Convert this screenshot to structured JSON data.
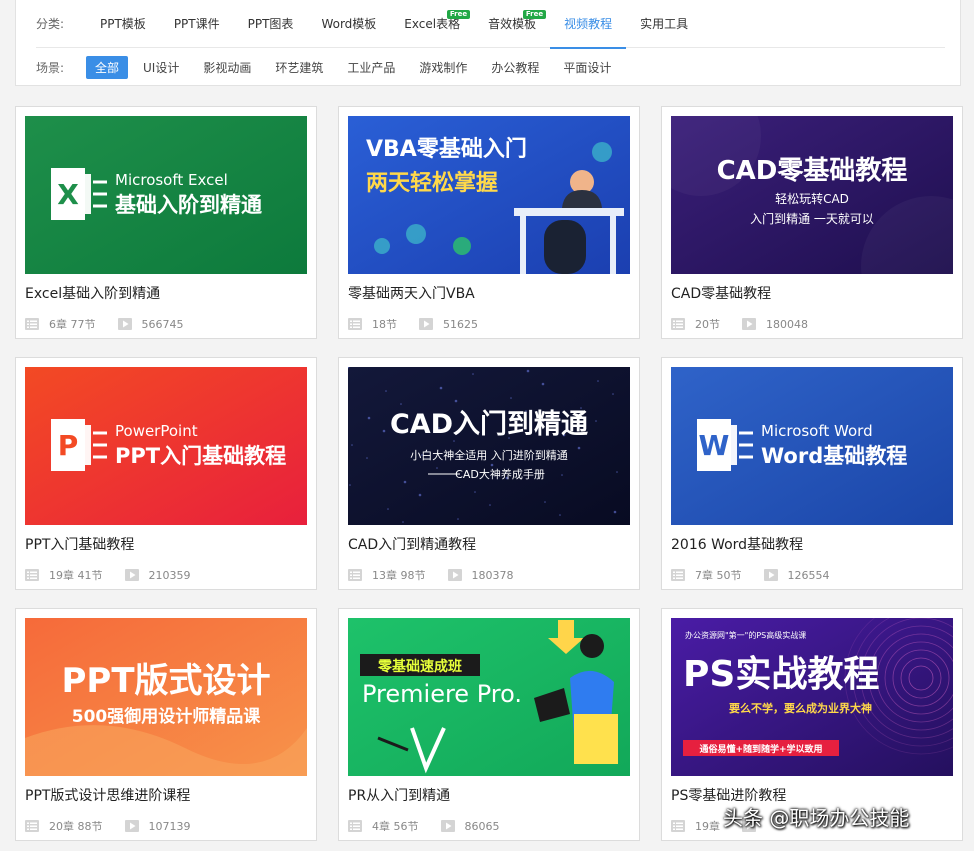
{
  "filters": {
    "category_label": "分类:",
    "categories": [
      {
        "label": "PPT模板",
        "free": false,
        "active": false
      },
      {
        "label": "PPT课件",
        "free": false,
        "active": false
      },
      {
        "label": "PPT图表",
        "free": false,
        "active": false
      },
      {
        "label": "Word模板",
        "free": false,
        "active": false
      },
      {
        "label": "Excel表格",
        "free": true,
        "active": false
      },
      {
        "label": "音效模板",
        "free": true,
        "active": false
      },
      {
        "label": "视频教程",
        "free": false,
        "active": true
      },
      {
        "label": "实用工具",
        "free": false,
        "active": false
      }
    ],
    "free_badge": "Free",
    "scene_label": "场景:",
    "scenes": [
      {
        "label": "全部",
        "active": true
      },
      {
        "label": "UI设计",
        "active": false
      },
      {
        "label": "影视动画",
        "active": false
      },
      {
        "label": "环艺建筑",
        "active": false
      },
      {
        "label": "工业产品",
        "active": false
      },
      {
        "label": "游戏制作",
        "active": false
      },
      {
        "label": "办公教程",
        "active": false
      },
      {
        "label": "平面设计",
        "active": false
      }
    ]
  },
  "courses": [
    {
      "title": "Excel基础入阶到精通",
      "sections": "6章 77节",
      "views": "566745",
      "thumb": {
        "style": "office",
        "bg1": "#1e8f4a",
        "bg2": "#0d7a3c",
        "app": "X",
        "app_name": "Microsoft Excel",
        "subtitle": "基础入阶到精通"
      }
    },
    {
      "title": "零基础两天入门VBA",
      "sections": "18节",
      "views": "51625",
      "thumb": {
        "style": "vba",
        "bg1": "#2a5fd6",
        "bg2": "#1b3fb0",
        "line1": "VBA零基础入门",
        "line2": "两天轻松掌握"
      }
    },
    {
      "title": "CAD零基础教程",
      "sections": "20节",
      "views": "180048",
      "thumb": {
        "style": "cad1",
        "bg1": "#3b1f7a",
        "bg2": "#1e0f4e",
        "line1": "CAD零基础教程",
        "line2": "轻松玩转CAD",
        "line3": "入门到精通 一天就可以"
      }
    },
    {
      "title": "PPT入门基础教程",
      "sections": "19章 41节",
      "views": "210359",
      "thumb": {
        "style": "office",
        "bg1": "#f34a24",
        "bg2": "#e8203c",
        "app": "P",
        "app_name": "PowerPoint",
        "subtitle": "PPT入门基础教程"
      }
    },
    {
      "title": "CAD入门到精通教程",
      "sections": "13章 98节",
      "views": "180378",
      "thumb": {
        "style": "cad2",
        "bg1": "#13183a",
        "bg2": "#080b22",
        "line1": "CAD入门到精通",
        "line2": "小白大神全适用 入门进阶到精通",
        "line3": "CAD大神养成手册"
      }
    },
    {
      "title": "2016 Word基础教程",
      "sections": "7章 50节",
      "views": "126554",
      "thumb": {
        "style": "office",
        "bg1": "#2f63c9",
        "bg2": "#1b46a8",
        "app": "W",
        "app_name": "Microsoft Word",
        "subtitle": "Word基础教程"
      }
    },
    {
      "title": "PPT版式设计思维进阶课程",
      "sections": "20章 88节",
      "views": "107139",
      "thumb": {
        "style": "pptdesign",
        "bg1": "#f66a3a",
        "bg2": "#f7934a",
        "line1": "PPT版式设计",
        "line2": "500强御用设计师精品课"
      }
    },
    {
      "title": "PR从入门到精通",
      "sections": "4章 56节",
      "views": "86065",
      "thumb": {
        "style": "pr",
        "bg1": "#1ec26a",
        "bg2": "#12a859",
        "line1": "零基础速成班",
        "line2": "Premiere Pro."
      }
    },
    {
      "title": "PS零基础进阶教程",
      "sections": "19章",
      "views": "",
      "thumb": {
        "style": "ps",
        "bg1": "#4a1ca6",
        "bg2": "#24105e",
        "line0": "办公资源网\"第一\"的PS高级实战课",
        "line1": "PS实战教程",
        "line2": "要么不学，要么成为业界大神",
        "line3": "通俗易懂+随到随学+学以致用"
      }
    }
  ],
  "watermark": "头条 @职场办公技能"
}
